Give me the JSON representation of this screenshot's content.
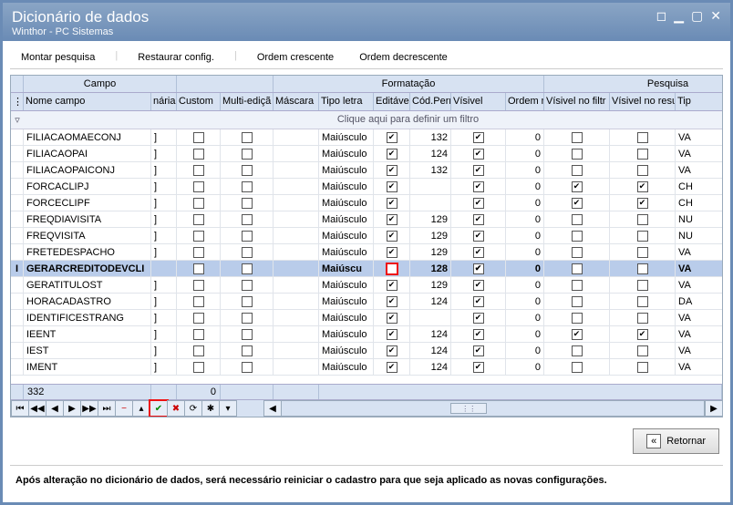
{
  "window": {
    "title": "Dicionário de dados",
    "subtitle": "Winthor - PC Sistemas"
  },
  "menu": {
    "montar": "Montar pesquisa",
    "restaurar": "Restaurar config.",
    "ordem_c": "Ordem crescente",
    "ordem_d": "Ordem decrescente"
  },
  "groups": {
    "campo": "Campo",
    "formatacao": "Formatação",
    "pesquisa": "Pesquisa"
  },
  "columns": {
    "nome": "Nome campo",
    "naria": "nária",
    "custom": "Custom",
    "multi": "Multi-ediçã",
    "mascara": "Máscara",
    "tipoletra": "Tipo letra",
    "editavel": "Editável",
    "codperm": "Cód.Permiss",
    "visivel": "Vísivel",
    "ordem": "Ordem no res",
    "visfiltro": "Vísivel no filtr",
    "visresult": "Vísivel no resultado",
    "tip": "Tip"
  },
  "filter_hint": "Clique aqui para definir um filtro",
  "rows": [
    {
      "mark": "",
      "nome": "FILIACAOMAECONJ",
      "n": "]",
      "custom": false,
      "multi": false,
      "mascara": "",
      "tipo": "Maiúsculo",
      "edit": true,
      "cod": "132",
      "vis": true,
      "ordem": "0",
      "vf": false,
      "vr": false,
      "tip": "VA"
    },
    {
      "mark": "",
      "nome": "FILIACAOPAI",
      "n": "]",
      "custom": false,
      "multi": false,
      "mascara": "",
      "tipo": "Maiúsculo",
      "edit": true,
      "cod": "124",
      "vis": true,
      "ordem": "0",
      "vf": false,
      "vr": false,
      "tip": "VA"
    },
    {
      "mark": "",
      "nome": "FILIACAOPAICONJ",
      "n": "]",
      "custom": false,
      "multi": false,
      "mascara": "",
      "tipo": "Maiúsculo",
      "edit": true,
      "cod": "132",
      "vis": true,
      "ordem": "0",
      "vf": false,
      "vr": false,
      "tip": "VA"
    },
    {
      "mark": "",
      "nome": "FORCACLIPJ",
      "n": "]",
      "custom": false,
      "multi": false,
      "mascara": "",
      "tipo": "Maiúsculo",
      "edit": true,
      "cod": "",
      "vis": true,
      "ordem": "0",
      "vf": true,
      "vr": true,
      "tip": "CH"
    },
    {
      "mark": "",
      "nome": "FORCECLIPF",
      "n": "]",
      "custom": false,
      "multi": false,
      "mascara": "",
      "tipo": "Maiúsculo",
      "edit": true,
      "cod": "",
      "vis": true,
      "ordem": "0",
      "vf": true,
      "vr": true,
      "tip": "CH"
    },
    {
      "mark": "",
      "nome": "FREQDIAVISITA",
      "n": "]",
      "custom": false,
      "multi": false,
      "mascara": "",
      "tipo": "Maiúsculo",
      "edit": true,
      "cod": "129",
      "vis": true,
      "ordem": "0",
      "vf": false,
      "vr": false,
      "tip": "NU"
    },
    {
      "mark": "",
      "nome": "FREQVISITA",
      "n": "]",
      "custom": false,
      "multi": false,
      "mascara": "",
      "tipo": "Maiúsculo",
      "edit": true,
      "cod": "129",
      "vis": true,
      "ordem": "0",
      "vf": false,
      "vr": false,
      "tip": "NU"
    },
    {
      "mark": "",
      "nome": "FRETEDESPACHO",
      "n": "]",
      "custom": false,
      "multi": false,
      "mascara": "",
      "tipo": "Maiúsculo",
      "edit": true,
      "cod": "129",
      "vis": true,
      "ordem": "0",
      "vf": false,
      "vr": false,
      "tip": "VA"
    },
    {
      "mark": "I",
      "nome": "GERARCREDITODEVCLI",
      "n": "",
      "custom": false,
      "multi": false,
      "mascara": "",
      "tipo": "Maiúscu",
      "edit": false,
      "cod": "128",
      "vis": true,
      "ordem": "0",
      "vf": false,
      "vr": false,
      "tip": "VA",
      "sel": true,
      "hl_edit": true
    },
    {
      "mark": "",
      "nome": "GERATITULOST",
      "n": "]",
      "custom": false,
      "multi": false,
      "mascara": "",
      "tipo": "Maiúsculo",
      "edit": true,
      "cod": "129",
      "vis": true,
      "ordem": "0",
      "vf": false,
      "vr": false,
      "tip": "VA"
    },
    {
      "mark": "",
      "nome": "HORACADASTRO",
      "n": "]",
      "custom": false,
      "multi": false,
      "mascara": "",
      "tipo": "Maiúsculo",
      "edit": true,
      "cod": "124",
      "vis": true,
      "ordem": "0",
      "vf": false,
      "vr": false,
      "tip": "DA"
    },
    {
      "mark": "",
      "nome": "IDENTIFICESTRANG",
      "n": "]",
      "custom": false,
      "multi": false,
      "mascara": "",
      "tipo": "Maiúsculo",
      "edit": true,
      "cod": "",
      "vis": true,
      "ordem": "0",
      "vf": false,
      "vr": false,
      "tip": "VA"
    },
    {
      "mark": "",
      "nome": "IEENT",
      "n": "]",
      "custom": false,
      "multi": false,
      "mascara": "",
      "tipo": "Maiúsculo",
      "edit": true,
      "cod": "124",
      "vis": true,
      "ordem": "0",
      "vf": true,
      "vr": true,
      "tip": "VA"
    },
    {
      "mark": "",
      "nome": "IEST",
      "n": "]",
      "custom": false,
      "multi": false,
      "mascara": "",
      "tipo": "Maiúsculo",
      "edit": true,
      "cod": "124",
      "vis": true,
      "ordem": "0",
      "vf": false,
      "vr": false,
      "tip": "VA"
    },
    {
      "mark": "",
      "nome": "IMENT",
      "n": "]",
      "custom": false,
      "multi": false,
      "mascara": "",
      "tipo": "Maiúsculo",
      "edit": true,
      "cod": "124",
      "vis": true,
      "ordem": "0",
      "vf": false,
      "vr": false,
      "tip": "VA"
    }
  ],
  "summary": {
    "count": "332",
    "custom_sum": "0"
  },
  "nav": {
    "first": "⏮",
    "prev_pg": "◀◀",
    "prev": "◀",
    "next": "▶",
    "next_pg": "▶▶",
    "last": "⏭",
    "minus": "−",
    "up": "▴",
    "check": "✔",
    "x": "✖",
    "refresh": "⟳",
    "star": "✱",
    "filter": "▾"
  },
  "footer": {
    "retornar": "Retornar"
  },
  "notice": "Após alteração no dicionário de dados, será necessário reiniciar o cadastro para que seja aplicado as novas configurações."
}
